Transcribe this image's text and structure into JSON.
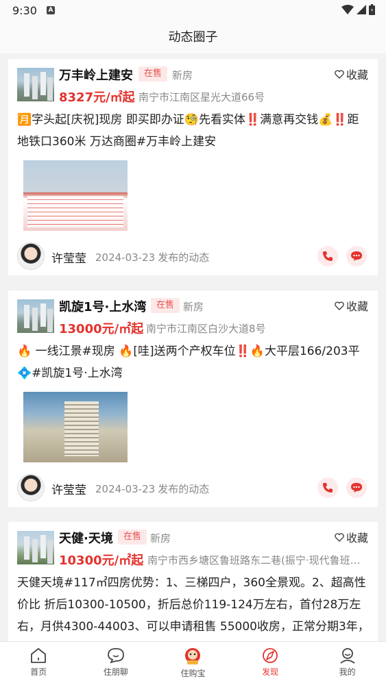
{
  "status": {
    "time": "9:30",
    "notification_icon": "A"
  },
  "header": {
    "title": "动态圈子"
  },
  "posts": [
    {
      "property_name": "万丰岭上建安",
      "status_badge": "在售",
      "property_type": "新房",
      "favorite_label": "收藏",
      "price": "8327元/㎡起",
      "address": "南宁市江南区星光大道66号",
      "text": "🈷️字头起[庆祝]现房 即买即办证🧐先看实体‼️满意再交钱💰‼️距地铁口360米 万达商圈#万丰岭上建安",
      "agent_name": "许莹莹",
      "post_date": "2024-03-23",
      "post_suffix": "发布的动态"
    },
    {
      "property_name": "凯旋1号·上水湾",
      "status_badge": "在售",
      "property_type": "新房",
      "favorite_label": "收藏",
      "price": "13000元/㎡起",
      "address": "南宁市江南区白沙大道8号",
      "text": "🔥 一线江景#现房 🔥[哇]送两个产权车位‼️🔥大平层166/203平💠#凯旋1号·上水湾",
      "agent_name": "许莹莹",
      "post_date": "2024-03-23",
      "post_suffix": "发布的动态"
    },
    {
      "property_name": "天健·天境",
      "status_badge": "在售",
      "property_type": "新房",
      "favorite_label": "收藏",
      "price": "10300元/㎡起",
      "address": "南宁市西乡塘区鲁班路东二巷(振宁·现代鲁班东...",
      "text": "天健天境#117㎡四房优势：1、三梯四户，360全景观。2、超高性价比 折后10300-10500，折后总价119-124万左右，首付28万左右，月供4300-44003、可以申请租售 55000收房，正常分期3年，"
    }
  ],
  "tabbar": {
    "items": [
      {
        "label": "首页",
        "icon": "home-icon"
      },
      {
        "label": "住朋聊",
        "icon": "chat-bubble-icon"
      },
      {
        "label": "住购宝",
        "icon": "mascot-icon"
      },
      {
        "label": "发现",
        "icon": "compass-icon"
      },
      {
        "label": "我的",
        "icon": "profile-icon"
      }
    ],
    "active": "发现"
  },
  "colors": {
    "accent": "#e3322d",
    "badge_bg": "#fde8e8",
    "badge_text": "#e8534f"
  }
}
